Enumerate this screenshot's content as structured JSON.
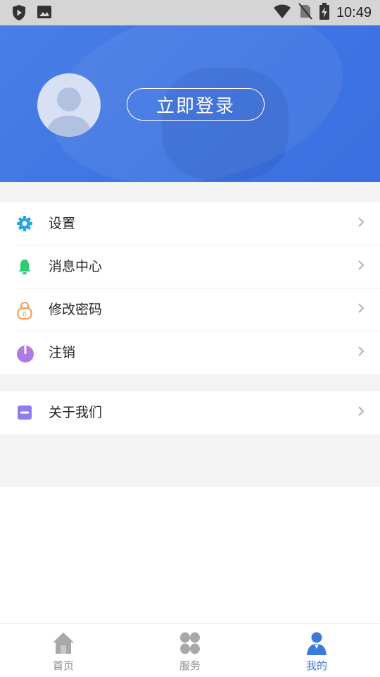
{
  "status_bar": {
    "time": "10:49"
  },
  "header": {
    "login_label": "立即登录"
  },
  "menu_group_1": [
    {
      "name": "settings",
      "label": "设置",
      "icon": "gear-icon",
      "color": "#1fa6ea"
    },
    {
      "name": "message-center",
      "label": "消息中心",
      "icon": "bell-icon",
      "color": "#2ecc71"
    },
    {
      "name": "change-password",
      "label": "修改密码",
      "icon": "lock-icon",
      "color": "#f39c4c"
    },
    {
      "name": "logout",
      "label": "注销",
      "icon": "power-icon",
      "color": "#b07ae0"
    }
  ],
  "menu_group_2": [
    {
      "name": "about-us",
      "label": "关于我们",
      "icon": "info-card-icon",
      "color": "#8e7cf0"
    }
  ],
  "bottom_nav": [
    {
      "label": "首页",
      "icon": "home-icon",
      "active": false
    },
    {
      "label": "服务",
      "icon": "services-icon",
      "active": false
    },
    {
      "label": "我的",
      "icon": "profile-icon",
      "active": true
    }
  ],
  "colors": {
    "primary": "#3d74e3",
    "active_tab": "#3a7bdc"
  }
}
